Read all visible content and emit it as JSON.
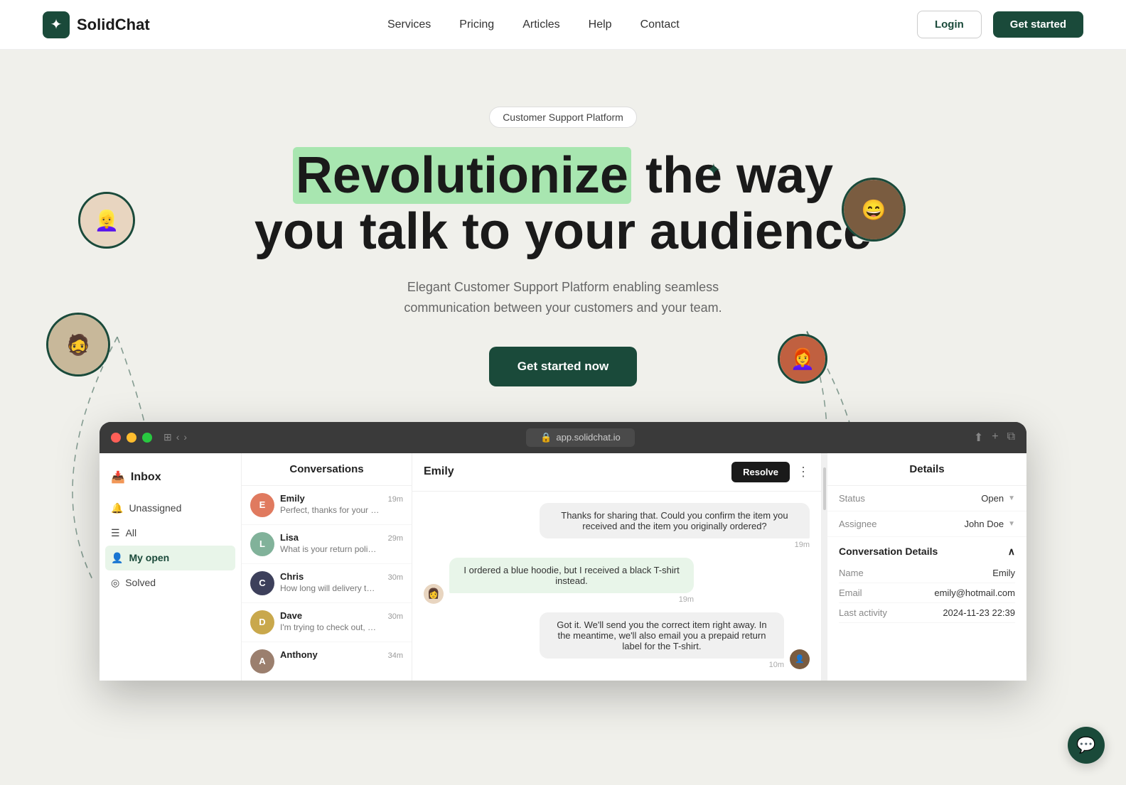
{
  "navbar": {
    "logo_text": "SolidChat",
    "nav_items": [
      "Services",
      "Pricing",
      "Articles",
      "Help",
      "Contact"
    ],
    "login_label": "Login",
    "get_started_label": "Get started"
  },
  "hero": {
    "badge": "Customer Support Platform",
    "title_part1": "Revolutionize",
    "title_part2": " the way you talk to your audience",
    "subtitle": "Elegant Customer Support Platform enabling seamless communication between your customers and your team.",
    "cta_label": "Get started now",
    "sparkle": "✦"
  },
  "app_window": {
    "url": "app.solidchat.io",
    "sidebar": {
      "inbox_label": "Inbox",
      "items": [
        {
          "label": "Unassigned",
          "icon": "🔔"
        },
        {
          "label": "All",
          "icon": "☰"
        },
        {
          "label": "My open",
          "icon": "👤"
        },
        {
          "label": "Solved",
          "icon": "◎"
        }
      ]
    },
    "conversations": {
      "header": "Conversations",
      "items": [
        {
          "name": "Emily",
          "preview": "Perfect, thanks for your help!",
          "time": "19m",
          "color": "#e07a5f"
        },
        {
          "name": "Lisa",
          "preview": "What is your return policy fo...",
          "time": "29m",
          "color": "#81b29a"
        },
        {
          "name": "Chris",
          "preview": "How long will delivery take to...",
          "time": "30m",
          "color": "#3d405b"
        },
        {
          "name": "Dave",
          "preview": "I'm trying to check out, but m...",
          "time": "30m",
          "color": "#f2cc8f"
        },
        {
          "name": "Anthony",
          "preview": "",
          "time": "34m",
          "color": "#9b7f6e"
        }
      ]
    },
    "chat": {
      "contact_name": "Emily",
      "resolve_label": "Resolve",
      "messages": [
        {
          "type": "agent",
          "text": "Thanks for sharing that. Could you confirm the item you received and the item you originally ordered?",
          "time": "19m"
        },
        {
          "type": "customer",
          "text": "I ordered a blue hoodie, but I received a black T-shirt instead.",
          "time": "19m"
        },
        {
          "type": "agent",
          "text": "Got it. We'll send you the correct item right away. In the meantime, we'll also email you a prepaid return label for the T-shirt.",
          "time": "10m"
        }
      ]
    },
    "details": {
      "header": "Details",
      "status_label": "Status",
      "status_value": "Open",
      "assignee_label": "Assignee",
      "assignee_value": "John Doe",
      "conversation_details_label": "Conversation Details",
      "name_label": "Name",
      "name_value": "Emily",
      "email_label": "Email",
      "email_value": "emily@hotmail.com",
      "last_activity_label": "Last activity",
      "last_activity_value": "2024-11-23 22:39"
    }
  },
  "chat_widget": {
    "icon": "💬"
  }
}
